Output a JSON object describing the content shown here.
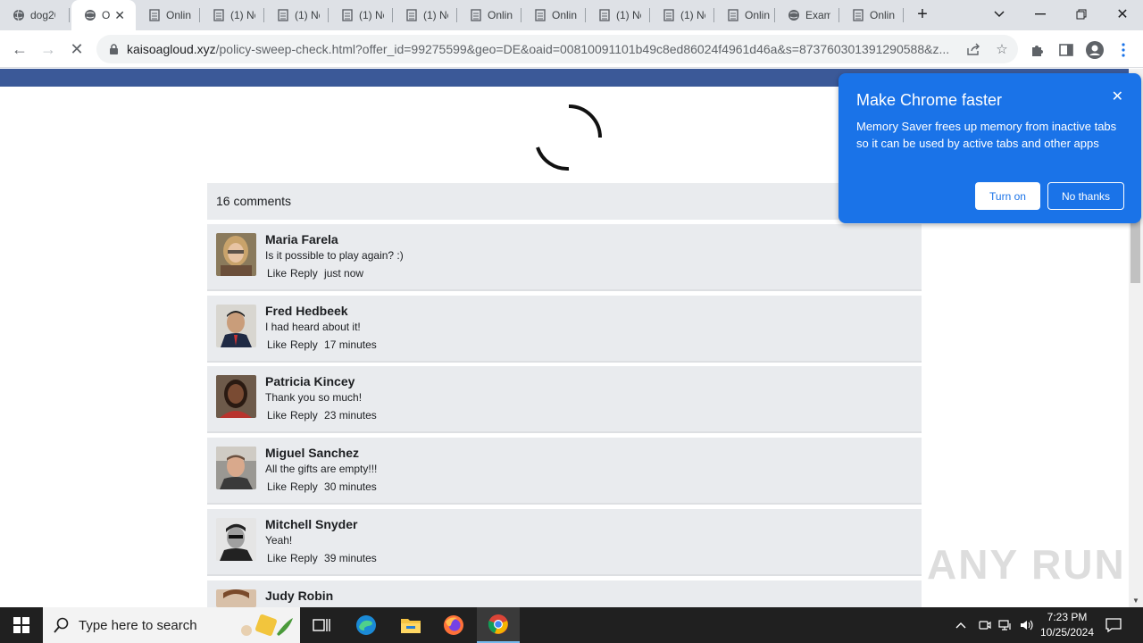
{
  "browser": {
    "tabs": [
      {
        "title": "dog20",
        "icon": "globe-icon"
      },
      {
        "title": "O",
        "icon": "globe-icon",
        "active": true
      },
      {
        "title": "Onlin",
        "icon": "document-icon"
      },
      {
        "title": "(1) No",
        "icon": "document-icon"
      },
      {
        "title": "(1) No",
        "icon": "document-icon"
      },
      {
        "title": "(1) No",
        "icon": "document-icon"
      },
      {
        "title": "(1) No",
        "icon": "document-icon"
      },
      {
        "title": "Onlin",
        "icon": "document-icon"
      },
      {
        "title": "Onlin",
        "icon": "document-icon"
      },
      {
        "title": "(1) No",
        "icon": "document-icon"
      },
      {
        "title": "(1) No",
        "icon": "document-icon"
      },
      {
        "title": "Onlin",
        "icon": "document-icon"
      },
      {
        "title": "Exam",
        "icon": "globe-icon"
      },
      {
        "title": "Onlin",
        "icon": "document-icon"
      }
    ],
    "url_host": "kaisoagloud.xyz",
    "url_path": "/policy-sweep-check.html?offer_id=99275599&geo=DE&oaid=00810091101b49c8ed86024f4961d46a&s=873760301391290588&z..."
  },
  "page": {
    "comments_header": "16 comments",
    "comments": [
      {
        "name": "Maria Farela",
        "text": "Is it possible to play again? :)",
        "like": "Like",
        "reply": "Reply",
        "time": "just now"
      },
      {
        "name": "Fred Hedbeek",
        "text": "I had heard about it!",
        "like": "Like",
        "reply": "Reply",
        "time": "17 minutes"
      },
      {
        "name": "Patricia Kincey",
        "text": "Thank you so much!",
        "like": "Like",
        "reply": "Reply",
        "time": "23 minutes"
      },
      {
        "name": "Miguel Sanchez",
        "text": "All the gifts are empty!!!",
        "like": "Like",
        "reply": "Reply",
        "time": "30 minutes"
      },
      {
        "name": "Mitchell Snyder",
        "text": "Yeah!",
        "like": "Like",
        "reply": "Reply",
        "time": "39 minutes"
      },
      {
        "name": "Judy Robin",
        "text": "",
        "like": "",
        "reply": "",
        "time": ""
      }
    ]
  },
  "popup": {
    "title": "Make Chrome faster",
    "text": "Memory Saver frees up memory from inactive tabs so it can be used by active tabs and other apps",
    "turn_on": "Turn on",
    "no_thanks": "No thanks"
  },
  "watermark": "ANY RUN",
  "taskbar": {
    "search_placeholder": "Type here to search",
    "time": "7:23 PM",
    "date": "10/25/2024"
  },
  "colors": {
    "facebook_blue": "#3b5998",
    "popup_blue": "#1a73e8",
    "comment_bg": "#e9ebee"
  }
}
